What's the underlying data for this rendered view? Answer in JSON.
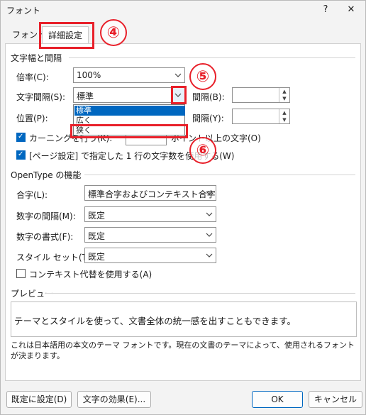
{
  "window": {
    "title": "フォント",
    "help_icon": "?",
    "close_icon": "✕"
  },
  "tabs": [
    {
      "label": "フォント",
      "active": false
    },
    {
      "label": "詳細設定",
      "active": true
    }
  ],
  "spacing_section": {
    "title": "文字幅と間隔",
    "scale": {
      "label": "倍率(C):",
      "value": "100%"
    },
    "spacing": {
      "label": "文字間隔(S):",
      "value": "標準"
    },
    "spacing_by": {
      "label": "間隔(B):",
      "value": ""
    },
    "position": {
      "label": "位置(P):"
    },
    "position_by": {
      "label": "間隔(Y):",
      "value": ""
    },
    "kerning": {
      "label": "カーニングを行う(K):",
      "trailing": "ポイント以上の文字(O)",
      "checked": true
    },
    "page_setup_grid": {
      "label": "[ページ設定] で指定した 1 行の文字数を使用する(W)",
      "checked": true
    },
    "dropdown_options": [
      "標準",
      "広く",
      "狭く"
    ],
    "dropdown_selected_index": 0
  },
  "opentype_section": {
    "title": "OpenType の機能",
    "ligatures": {
      "label": "合字(L):",
      "value": "標準合字およびコンテキスト合字"
    },
    "number_spacing": {
      "label": "数字の間隔(M):",
      "value": "既定"
    },
    "number_forms": {
      "label": "数字の書式(F):",
      "value": "既定"
    },
    "stylistic_sets": {
      "label": "スタイル セット(T):",
      "value": "既定"
    },
    "contextual_alternates": {
      "label": "コンテキスト代替を使用する(A)",
      "checked": false
    }
  },
  "preview_section": {
    "title": "プレビュー",
    "sample_text": "テーマとスタイルを使って、文書全体の統一感を出すこともできます。",
    "description": "これは日本語用の本文のテーマ フォントです。現在の文書のテーマによって、使用されるフォントが決まります。"
  },
  "footer": {
    "set_default": "既定に設定(D)",
    "text_effects": "文字の効果(E)...",
    "ok": "OK",
    "cancel": "キャンセル"
  },
  "annotations": [
    "④",
    "⑤",
    "⑥"
  ],
  "colors": {
    "accent": "#0067c0",
    "annotation": "#e8202a"
  }
}
